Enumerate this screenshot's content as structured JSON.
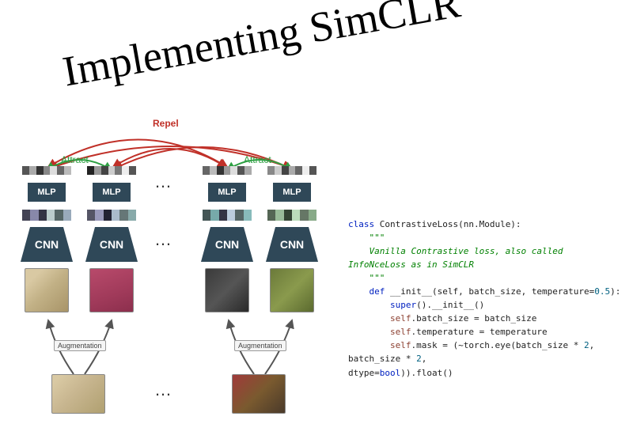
{
  "title": "Implementing SimCLR",
  "labels": {
    "repel": "Repel",
    "attract": "Attract",
    "mlp": "MLP",
    "cnn": "CNN",
    "augmentation": "Augmentation",
    "dots": "…"
  },
  "colors": {
    "repel": "#c03028",
    "attract": "#2ea043",
    "block": "#2f4858"
  },
  "code": {
    "l1_class": "class",
    "l1_name": " ContrastiveLoss(nn.Module):",
    "l2_q": "    \"\"\"",
    "l3_c": "    Vanilla Contrastive loss, also called InfoNceLoss as in SimCLR",
    "l4_q": "    \"\"\"",
    "l5_def": "    def",
    "l5_init": " __init__",
    "l5_self": "(self, batch_size, temperature=",
    "l5_num": "0.5",
    "l5_end": "):",
    "l6_super": "        super",
    "l6_call": "().__init__()",
    "l7_self": "        self",
    "l7_rest": ".batch_size = batch_size",
    "l8_self": "        self",
    "l8_rest": ".temperature = temperature",
    "l9_self": "        self",
    "l9_mid": ".mask = (~torch.eye(batch_size * ",
    "l9_n1": "2",
    "l9_mid2": ", batch_size * ",
    "l9_n2": "2",
    "l9_end": ",",
    "l10_a": "dtype=",
    "l10_bool": "bool",
    "l10_b": ")).float()"
  }
}
